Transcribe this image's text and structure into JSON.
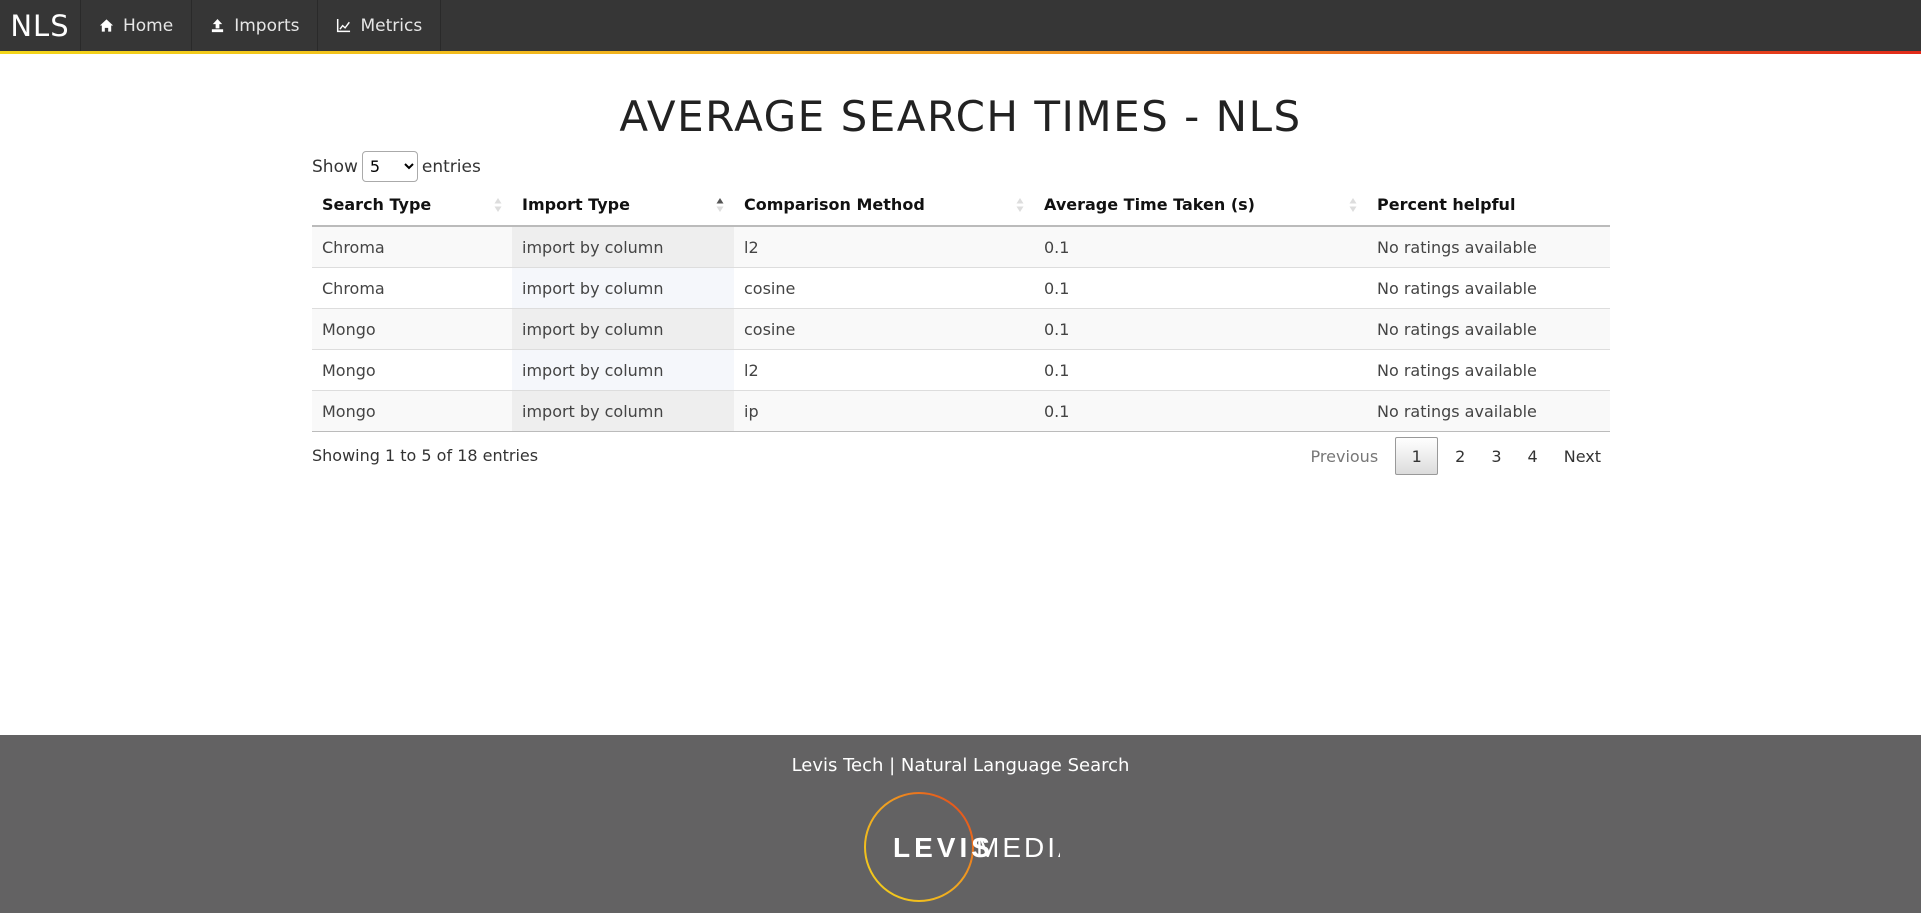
{
  "nav": {
    "brand": "NLS",
    "items": [
      {
        "label": "Home",
        "icon": "home-icon"
      },
      {
        "label": "Imports",
        "icon": "upload-icon"
      },
      {
        "label": "Metrics",
        "icon": "line-chart-icon"
      }
    ],
    "accent_gradient": [
      "#f3d61a",
      "#e22b1a"
    ]
  },
  "page": {
    "title": "AVERAGE SEARCH TIMES - NLS"
  },
  "table_controls": {
    "show_label": "Show",
    "page_size": "5",
    "entries_label": "entries"
  },
  "table": {
    "columns": [
      "Search Type",
      "Import Type",
      "Comparison Method",
      "Average Time Taken (s)",
      "Percent helpful"
    ],
    "sorted_column": "Import Type",
    "sort_direction": "ascending",
    "rows": [
      [
        "Chroma",
        "import by column",
        "l2",
        "0.1",
        "No ratings available"
      ],
      [
        "Chroma",
        "import by column",
        "cosine",
        "0.1",
        "No ratings available"
      ],
      [
        "Mongo",
        "import by column",
        "cosine",
        "0.1",
        "No ratings available"
      ],
      [
        "Mongo",
        "import by column",
        "l2",
        "0.1",
        "No ratings available"
      ],
      [
        "Mongo",
        "import by column",
        "ip",
        "0.1",
        "No ratings available"
      ]
    ]
  },
  "info": "Showing 1 to 5 of 18 entries",
  "pagination": {
    "previous": "Previous",
    "pages": [
      "1",
      "2",
      "3",
      "4"
    ],
    "current": "1",
    "next": "Next"
  },
  "footer": {
    "text": "Levis Tech | Natural Language Search",
    "logo_text_bold": "LEVIS",
    "logo_text_light": "MEDIA",
    "background": "#636263"
  }
}
